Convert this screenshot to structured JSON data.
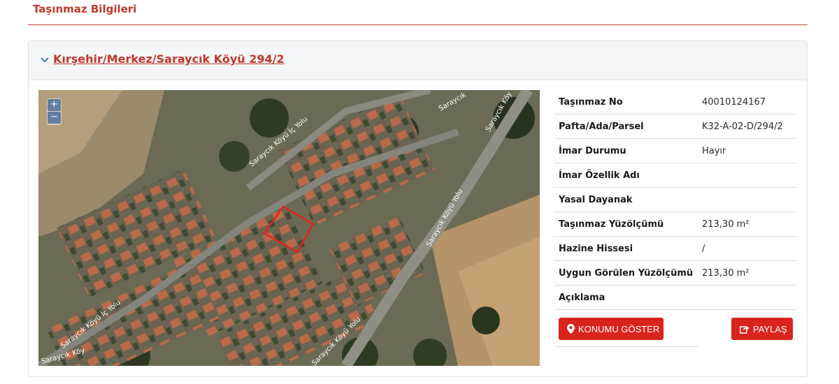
{
  "section_title": "Taşınmaz Bilgileri",
  "panel": {
    "title": "Kırşehir/Merkez/Saraycık Köyü 294/2",
    "toggle_icon": "chevron-down-icon"
  },
  "map": {
    "zoom_in": "+",
    "zoom_out": "−",
    "road_labels": [
      "Saraycık Köyü İç Yolu",
      "Saraycık Köyü Yolu",
      "Saraycık",
      "Saraycık Köy",
      "Saraycık Köyü İç Yolu",
      "Saraycık Köyü Yolu",
      "Saraycık Köy"
    ],
    "parcel_outline_color": "#e8221c"
  },
  "info": {
    "rows": [
      {
        "label": "Taşınmaz No",
        "value": "40010124167"
      },
      {
        "label": "Pafta/Ada/Parsel",
        "value": "K32-A-02-D/294/2"
      },
      {
        "label": "İmar Durumu",
        "value": "Hayır"
      },
      {
        "label": "İmar Özellik Adı",
        "value": ""
      },
      {
        "label": "Yasal Dayanak",
        "value": ""
      },
      {
        "label": "Taşınmaz Yüzölçümü",
        "value": "213,30 m²"
      },
      {
        "label": "Hazine Hissesi",
        "value": "/"
      },
      {
        "label": "Uygun Görülen Yüzölçümü",
        "value": "213,30 m²"
      },
      {
        "label": "Açıklama",
        "value": ""
      }
    ]
  },
  "buttons": {
    "show_location": "KONUMU GÖSTER",
    "share": "PAYLAŞ"
  },
  "colors": {
    "accent": "#c0392b",
    "button": "#d9241c"
  }
}
